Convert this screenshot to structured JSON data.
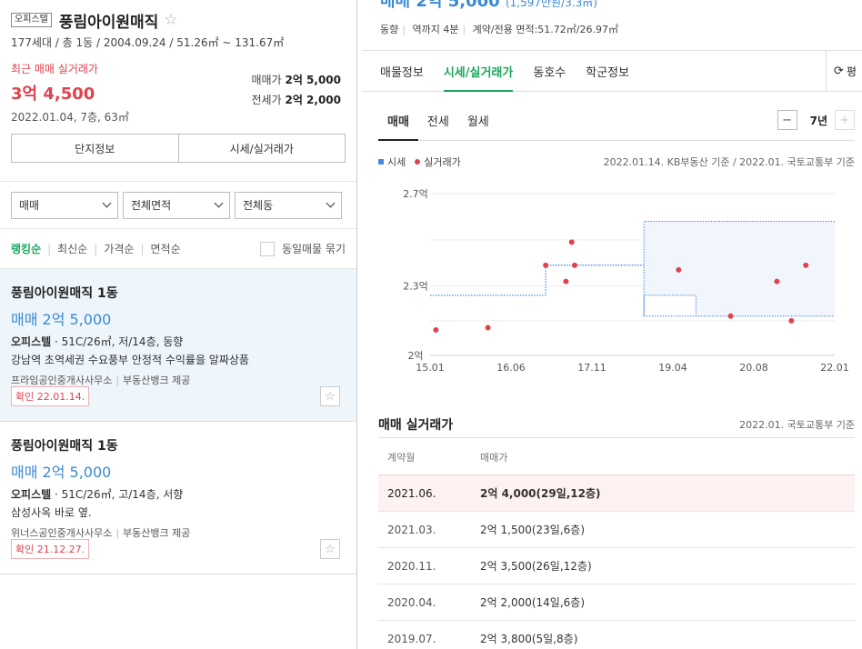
{
  "complex": {
    "type_badge": "오피스텔",
    "name": "풍림아이원매직",
    "meta": "177세대 / 총 1동 / 2004.09.24 / 51.26㎡ ~ 131.67㎡",
    "recent_label": "최근 매매 실거래가",
    "recent_price": "3억 4,500",
    "recent_date": "2022.01.04, 7층, 63㎡",
    "sale_label": "매매가",
    "sale_price": "2억 5,000",
    "jeonse_label": "전세가",
    "jeonse_price": "2억 2,000",
    "btn_info": "단지정보",
    "btn_market": "시세/실거래가"
  },
  "filters": [
    "매매",
    "전체면적",
    "전체동"
  ],
  "sort": {
    "options": [
      "랭킹순",
      "최신순",
      "가격순",
      "면적순"
    ],
    "same_label": "동일매물 묶기"
  },
  "listings": [
    {
      "name": "풍림아이원매직 1동",
      "price": "매매 2억 5,000",
      "type": "오피스텔",
      "detail": "51C/26㎡, 저/14층, 동향",
      "desc": "강남역 초역세권 수요풍부 안정적 수익률을 알짜상품",
      "agent": "프라임공인중개사사무소",
      "provider": "부동산뱅크 제공",
      "confirm": "확인 22.01.14."
    },
    {
      "name": "풍림아이원매직 1동",
      "price": "매매 2억 5,000",
      "type": "오피스텔",
      "detail": "51C/26㎡, 고/14층, 서향",
      "desc": "삼성사옥 바로 옆.",
      "agent": "위너스공인중개사사무소",
      "provider": "부동산뱅크 제공",
      "confirm": "확인 21.12.27."
    }
  ],
  "right": {
    "price_main": "매매 2억 5,000",
    "price_sub": "(1,597만원/3.3㎡)",
    "sub_items": [
      "동향",
      "역까지 4분",
      "계약/전용 면적:51.72㎡/26.97㎡"
    ],
    "tabs": [
      "매물정보",
      "시세/실거래가",
      "동호수",
      "학군정보"
    ],
    "refresh_label": "평",
    "subtabs": [
      "매매",
      "전세",
      "월세"
    ],
    "years_value": "7년",
    "legend_market": "시세",
    "legend_trade": "실거래가",
    "chart_basis": "2022.01.14. KB부동산 기준 / 2022.01. 국토교통부 기준"
  },
  "chart_data": {
    "type": "line",
    "x_ticks": [
      "15.01",
      "16.06",
      "17.11",
      "19.04",
      "20.08",
      "22.01"
    ],
    "y_ticks": [
      "2.7억",
      "2.3억",
      "2억"
    ],
    "ylim": [
      2.0,
      2.7
    ],
    "xlim": [
      2015.0,
      2022.0
    ],
    "series": [
      {
        "name": "시세",
        "color": "#4a89dc",
        "upper": [
          [
            2015.0,
            2.26
          ],
          [
            2017.0,
            2.26
          ],
          [
            2017.0,
            2.39
          ],
          [
            2018.7,
            2.39
          ],
          [
            2018.7,
            2.58
          ],
          [
            2022.0,
            2.58
          ]
        ],
        "lower": [
          [
            2015.0,
            2.26
          ],
          [
            2017.0,
            2.26
          ],
          [
            2017.0,
            2.39
          ],
          [
            2018.7,
            2.39
          ],
          [
            2018.7,
            2.17
          ],
          [
            2022.0,
            2.17
          ]
        ],
        "inner": [
          [
            2018.7,
            2.17
          ],
          [
            2018.7,
            2.26
          ],
          [
            2019.6,
            2.26
          ],
          [
            2019.6,
            2.17
          ]
        ]
      },
      {
        "name": "실거래가",
        "color": "#e0434e",
        "points": [
          [
            2015.1,
            2.11
          ],
          [
            2016.0,
            2.12
          ],
          [
            2017.0,
            2.39
          ],
          [
            2017.35,
            2.32
          ],
          [
            2017.45,
            2.49
          ],
          [
            2017.5,
            2.39
          ],
          [
            2019.3,
            2.37
          ],
          [
            2020.2,
            2.17
          ],
          [
            2021.0,
            2.32
          ],
          [
            2021.25,
            2.15
          ],
          [
            2021.5,
            2.39
          ]
        ]
      }
    ]
  },
  "transactions": {
    "title": "매매 실거래가",
    "basis": "2022.01. 국토교통부 기준",
    "head": [
      "계약월",
      "매매가"
    ],
    "rows": [
      {
        "month": "2021.06.",
        "price": "2억 4,000(29일,12층)"
      },
      {
        "month": "2021.03.",
        "price": "2억 1,500(23일,6층)"
      },
      {
        "month": "2020.11.",
        "price": "2억 3,500(26일,12층)"
      },
      {
        "month": "2020.04.",
        "price": "2억 2,000(14일,6층)"
      },
      {
        "month": "2019.07.",
        "price": "2억 3,800(5일,8층)"
      }
    ]
  }
}
